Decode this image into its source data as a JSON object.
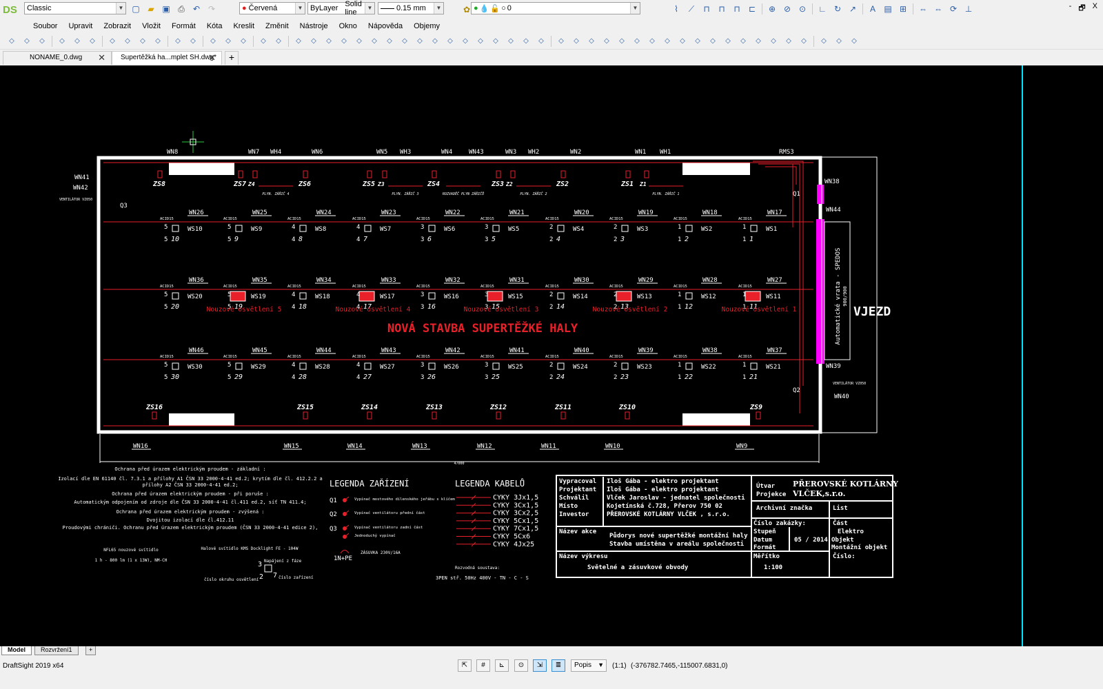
{
  "app": {
    "name": "DraftSight 2019 x64",
    "logo": "DS"
  },
  "toolbar1": {
    "workspace": "Classic",
    "color": "Červená",
    "color_hex": "#e02020",
    "linetype_layer": "ByLayer",
    "linetype": "Solid line",
    "lineweight": "0.15 mm",
    "layer": "0"
  },
  "window_controls": {
    "minimize": "-",
    "restore": "🗗",
    "close": "X"
  },
  "menu": [
    "Soubor",
    "Upravit",
    "Zobrazit",
    "Vložit",
    "Formát",
    "Kóta",
    "Kreslit",
    "Změnit",
    "Nástroje",
    "Okno",
    "Nápověda",
    "Objemy"
  ],
  "tabs": [
    {
      "label": "NONAME_0.dwg",
      "active": false
    },
    {
      "label": "Supertěžká ha...mplet SH.dwg*",
      "active": true
    }
  ],
  "layout_tabs": [
    "Model",
    "Rozvržení1"
  ],
  "status": {
    "annotation": "Popis",
    "scale": "(1:1)",
    "coords": "(-376782.7465,-115007.6831,0)"
  },
  "colors": {
    "drawing_red": "#e8202a",
    "magenta": "#ff00ff",
    "cyan": "#00e5ff",
    "canvas": "#000000"
  },
  "drawing": {
    "title": "NOVÁ STAVBA SUPERTĚŽKÉ HALY",
    "entrance": "VJEZD",
    "gate": "Automatické vrata - SPEDOS",
    "gate_size": "900/900",
    "dimension": "47000",
    "top_labels": [
      [
        "WN8",
        252
      ],
      [
        "WN7",
        370
      ],
      [
        "WH4",
        402
      ],
      [
        "WN6",
        462
      ],
      [
        "WN5",
        556
      ],
      [
        "WH3",
        590
      ],
      [
        "WN4",
        650
      ],
      [
        "WN43",
        690
      ],
      [
        "WN3",
        743
      ],
      [
        "WH2",
        776
      ],
      [
        "WN2",
        837
      ],
      [
        "WN1",
        931
      ],
      [
        "WH1",
        967
      ],
      [
        "RMS3",
        1140
      ]
    ],
    "top_zs": [
      [
        "ZS8",
        232
      ],
      [
        "ZS7",
        349
      ],
      [
        "Z4",
        370
      ],
      [
        "ZS6",
        443
      ],
      [
        "ZS5",
        536
      ],
      [
        "Z3",
        558
      ],
      [
        "ZS4",
        630
      ],
      [
        "ZS3",
        723
      ],
      [
        "Z2",
        744
      ],
      [
        "ZS2",
        817
      ],
      [
        "ZS1",
        911
      ],
      [
        "Z1",
        938
      ]
    ],
    "gas_heaters": [
      [
        "PLYN. ZÁŘIČ 4",
        400
      ],
      [
        "ROZVADĚČ PLYN ZÁŘIČŮ",
        672
      ],
      [
        "PLYN. ZÁŘIČ 3",
        588
      ],
      [
        "PLYN. ZÁŘIČ 2",
        774
      ],
      [
        "PLYN. ZÁŘIČ 1",
        966
      ]
    ],
    "bottom_zs": [
      [
        "ZS16",
        224
      ],
      [
        "ZS15",
        443
      ],
      [
        "ZS14",
        536
      ],
      [
        "ZS13",
        630
      ],
      [
        "ZS12",
        723
      ],
      [
        "ZS11",
        817
      ],
      [
        "ZS10",
        910
      ],
      [
        "ZS9",
        1100
      ]
    ],
    "bottom_wn": [
      [
        "WN16",
        205
      ],
      [
        "WN15",
        424
      ],
      [
        "WN14",
        516
      ],
      [
        "WN13",
        610
      ],
      [
        "WN12",
        704
      ],
      [
        "WN11",
        797
      ],
      [
        "WN10",
        890
      ],
      [
        "WN9",
        1080
      ]
    ],
    "outlet_label": "ACID15",
    "rows": [
      {
        "wn": [
          "WN26",
          "WN25",
          "WN24",
          "WN23",
          "WN22",
          "WN21",
          "WN20",
          "WN19",
          "WN18",
          "WN17"
        ],
        "ws": [
          "WS10",
          "WS9",
          "WS8",
          "WS7",
          "WS6",
          "WS5",
          "WS4",
          "WS3",
          "WS2",
          "WS1"
        ],
        "circ": [
          [
            "5",
            "10"
          ],
          [
            "5",
            "9"
          ],
          [
            "4",
            "8"
          ],
          [
            "4",
            "7"
          ],
          [
            "3",
            "6"
          ],
          [
            "3",
            "5"
          ],
          [
            "2",
            "4"
          ],
          [
            "2",
            "3"
          ],
          [
            "1",
            "2"
          ],
          [
            "1",
            "1"
          ]
        ],
        "emergency": []
      },
      {
        "wn": [
          "WN36",
          "WN35",
          "WN34",
          "WN33",
          "WN32",
          "WN31",
          "WN30",
          "WN29",
          "WN28",
          "WN27"
        ],
        "ws": [
          "WS20",
          "WS19",
          "WS18",
          "WS17",
          "WS16",
          "WS15",
          "WS14",
          "WS13",
          "WS12",
          "WS11"
        ],
        "circ": [
          [
            "5",
            "20"
          ],
          [
            "5",
            "19"
          ],
          [
            "4",
            "18"
          ],
          [
            "4",
            "17"
          ],
          [
            "3",
            "16"
          ],
          [
            "3",
            "15"
          ],
          [
            "2",
            "14"
          ],
          [
            "2",
            "13"
          ],
          [
            "1",
            "12"
          ],
          [
            "1",
            "11"
          ]
        ],
        "emergency": [
          "Nouzové osvětlení 5",
          "Nouzové osvětlení 4",
          "Nouzové osvětlení 3",
          "Nouzové osvětlení 2",
          "Nouzové osvětlení 1"
        ]
      },
      {
        "wn": [
          "WN46",
          "WN45",
          "WN44",
          "WN43",
          "WN42",
          "WN41",
          "WN40",
          "WN39",
          "WN38",
          "WN37"
        ],
        "ws": [
          "WS30",
          "WS29",
          "WS28",
          "WS27",
          "WS26",
          "WS25",
          "WS24",
          "WS23",
          "WS22",
          "WS21"
        ],
        "circ": [
          [
            "5",
            "30"
          ],
          [
            "5",
            "29"
          ],
          [
            "4",
            "28"
          ],
          [
            "4",
            "27"
          ],
          [
            "3",
            "26"
          ],
          [
            "3",
            "25"
          ],
          [
            "2",
            "24"
          ],
          [
            "2",
            "23"
          ],
          [
            "1",
            "22"
          ],
          [
            "1",
            "21"
          ]
        ],
        "emergency": []
      }
    ],
    "right_labels": {
      "wn38": "WN38",
      "wn44": "WN44",
      "q1": "Q1",
      "wn39": "WN39",
      "q2": "Q2",
      "wn40": "WN40",
      "ventilator": "VENTILÁTOR VZ050",
      "wn41": "WN41",
      "wn42": "WN42",
      "q3": "Q3"
    },
    "notes": [
      "Ochrana před úrazem elektrickým proudem - základní :",
      "Izolací dle EN 61140 čl. 7.3.1 a přílohy A1 ČSN 33 2000-4-41 ed.2; krytím dle čl. 412.2.2 a",
      "přílohy A2 ČSN 33 2000-4-41 ed.2;",
      "Ochrana před úrazem elektrickým proudem - při poruše :",
      "Automatickým odpojením od zdroje dle ČSN 33 2000-4-41 čl.411 ed.2, síť TN 411.4;",
      "Ochrana před úrazem elektrickým proudem - zvýšená :",
      "Dvojitou izolací dle čl.412.11",
      "Proudovými chrániči. Ochranu před úrazem elektrickým proudem (ČSN 33 2000-4-41 edice 2),"
    ],
    "emergency_note": [
      "NFL65 nouzové svítidlo",
      "1 h - 800 lm (1 x 13W), NM-CH"
    ],
    "hall_light_note": "Halové svítidlo KMS Docklight FE - 104W",
    "circuit_legend": {
      "phase": "Napájení z fáze",
      "circuit": "číslo okruhu osvětlení",
      "device": "číslo zařízení",
      "n1": "3",
      "n2": "2",
      "n3": "7"
    },
    "legend_devices": {
      "title": "LEGENDA ZAŘÍZENÍ",
      "items": [
        [
          "Q1",
          "Vypínač mostového dílenského jeřábu s klíčem"
        ],
        [
          "Q2",
          "Vypínač ventilátoru přední část"
        ],
        [
          "Q3",
          "Vypínač ventilátoru zadní část"
        ],
        [
          "",
          "Jednoduchý vypínač"
        ]
      ],
      "socket": "ZÁSUVKA 230V/16A",
      "socket_sym": "1N+PE"
    },
    "legend_cables": {
      "title": "LEGENDA KABELŮ",
      "items": [
        "CYKY 3Jx1,5",
        "CYKY 3Cx1,5",
        "CYKY 3Cx2,5",
        "CYKY 5Cx1,5",
        "CYKY 7Cx1,5",
        "CYKY 5Cx6",
        "CYKY 4Jx25"
      ]
    },
    "distribution": {
      "label": "Rozvodná soustava:",
      "value": "3PEN stř. 50Hz  400V - TN - C - S"
    },
    "title_block": {
      "rows": [
        [
          "Vypracoval",
          "Iloš Gába - elektro projektant"
        ],
        [
          "Projektant",
          "Iloš Gába - elektro projektant"
        ],
        [
          "Schválil",
          "Vlček Jaroslav - jednatel společnosti"
        ],
        [
          "Místo",
          "Kojetínská č.728, Přerov 750 02"
        ],
        [
          "Investor",
          "PŘEROVSKÉ KOTLÁRNY VLČEK , s.r.o."
        ]
      ],
      "akce_label": "Název akce",
      "akce": [
        "Půdorys nové supertěžké montážní haly",
        "Stavba umístěna v areálu společnosti"
      ],
      "vykres_label": "Název výkresu",
      "vykres": "Světelné a zásuvkové obvody",
      "utvar": "Útvar",
      "projekce": "Projekce",
      "company": [
        "PŘEROVSKÉ KOTLÁRNY",
        "VLČEK,s.r.o."
      ],
      "archiv": "Archivní značka",
      "list": "List",
      "zakazka": "Číslo zakázky:",
      "cast": "Část",
      "cast_val": "Elektro",
      "stupen": "Stupeň",
      "datum": "Datum",
      "datum_val": "05 / 2014",
      "objekt": "Objekt",
      "objekt_val": "Montážní objekt",
      "format": "Formát",
      "meritko": "Měřítko",
      "meritko_val": "1:100",
      "cislo": "Číslo:"
    }
  }
}
